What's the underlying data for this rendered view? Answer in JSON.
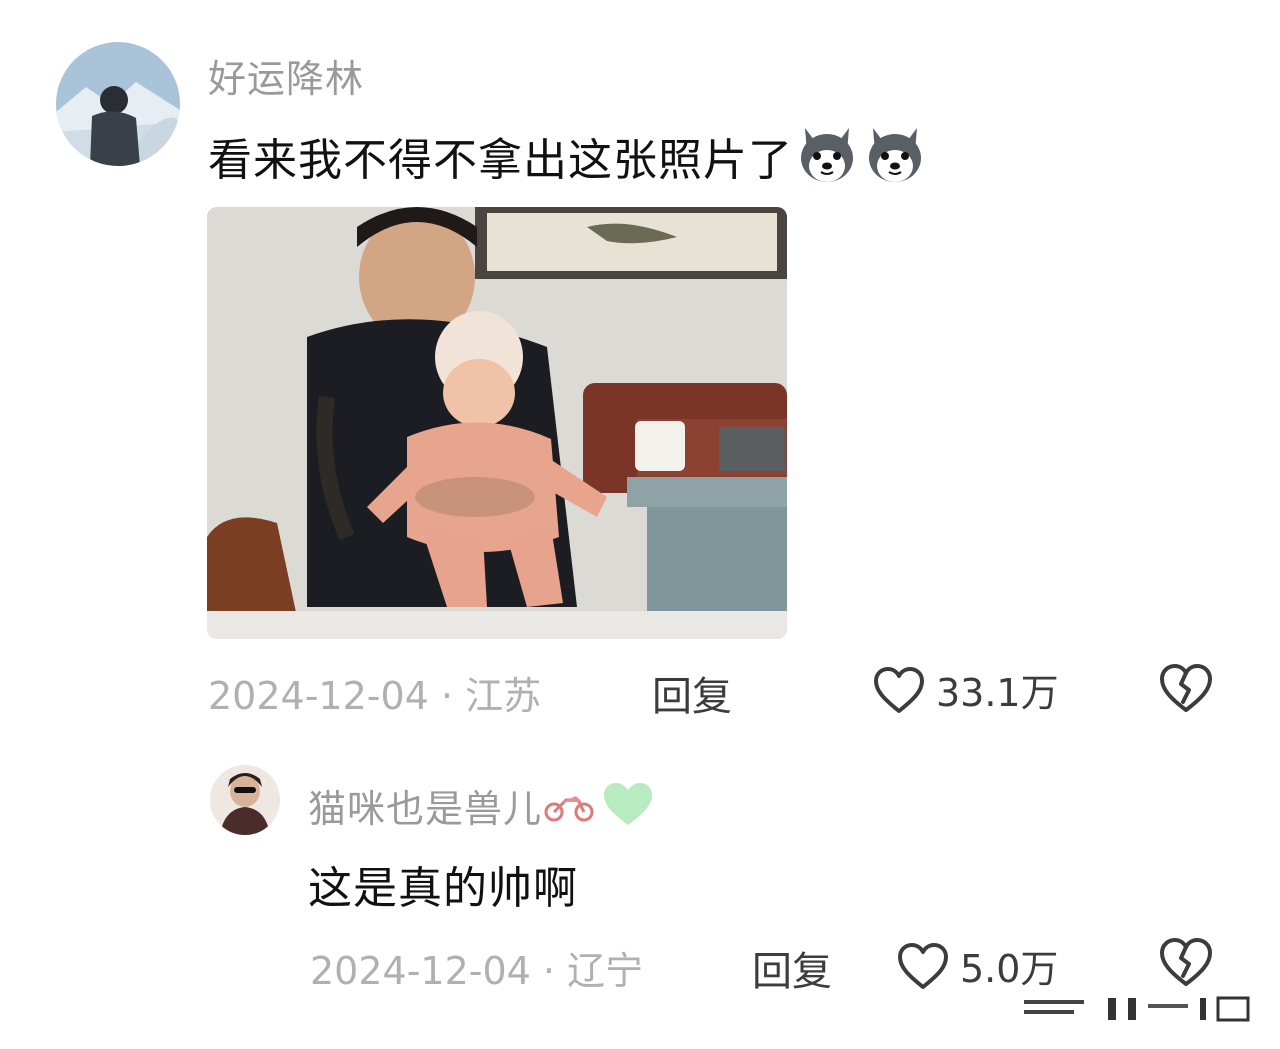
{
  "comment": {
    "username": "好运降林",
    "text": "看来我不得不拿出这张照片了",
    "emoji_icon": "husky-dog-emoji",
    "date_location": "2024-12-04 · 江苏",
    "reply_label": "回复",
    "like_count": "33.1万",
    "like_icon": "heart-outline-icon",
    "dislike_icon": "broken-heart-icon"
  },
  "reply": {
    "username": "猫咪也是兽儿",
    "badge_icons": [
      "motorcycle-icon",
      "green-heart-icon"
    ],
    "text": "这是真的帅啊",
    "date_location": "2024-12-04 · 辽宁",
    "reply_label": "回复",
    "like_count": "5.0万",
    "like_icon": "heart-outline-icon",
    "dislike_icon": "broken-heart-icon"
  },
  "colors": {
    "username": "#9a9a9a",
    "text": "#111111",
    "meta": "#b0b0b0",
    "action": "#3c3c3c",
    "green_heart": "#b9ebc0"
  }
}
